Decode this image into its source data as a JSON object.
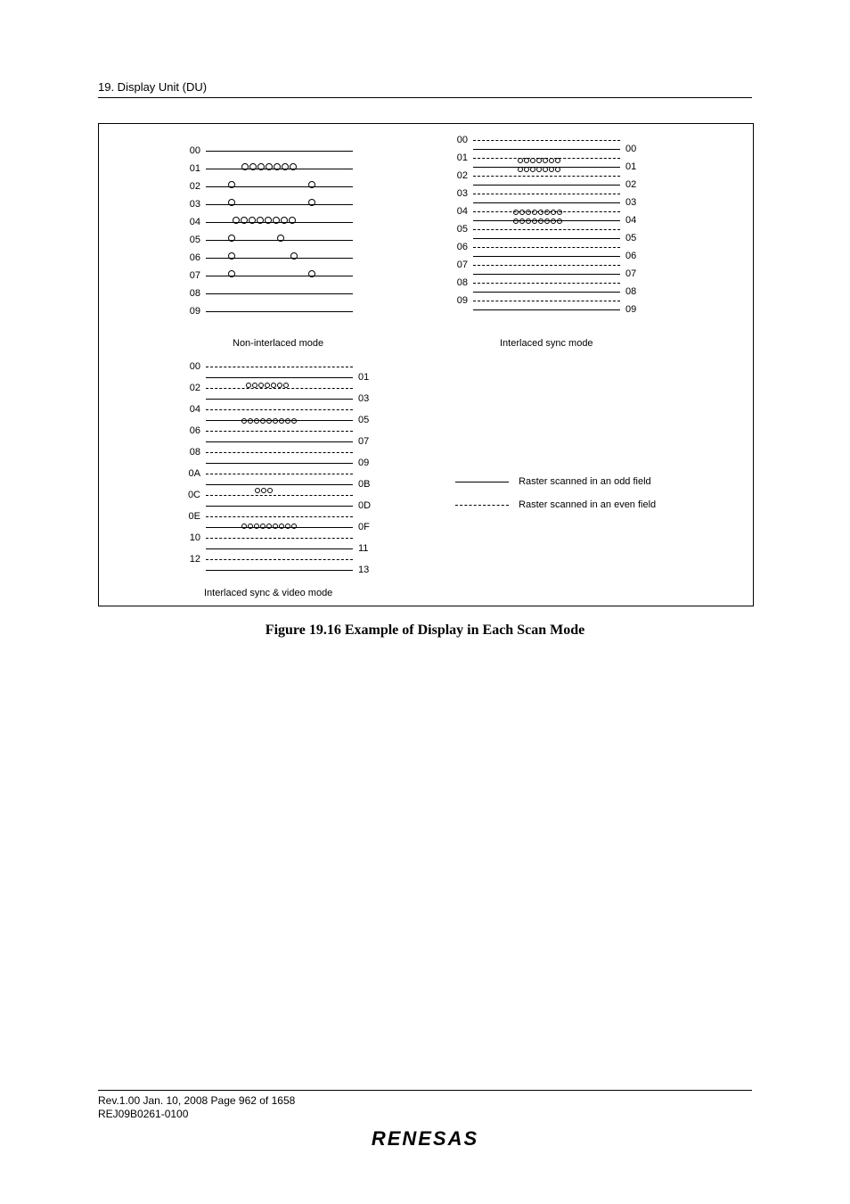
{
  "header": {
    "section": "19.   Display Unit (DU)"
  },
  "fig": {
    "panels": {
      "noninterlaced": {
        "labels": [
          "00",
          "01",
          "02",
          "03",
          "04",
          "05",
          "06",
          "07",
          "08",
          "09"
        ],
        "caption": "Non-interlaced mode"
      },
      "interlaced_sync": {
        "left": [
          "00",
          "01",
          "02",
          "03",
          "04",
          "05",
          "06",
          "07",
          "08",
          "09"
        ],
        "right": [
          "00",
          "01",
          "02",
          "03",
          "04",
          "05",
          "06",
          "07",
          "08",
          "09"
        ],
        "caption": "Interlaced sync mode"
      },
      "interlaced_sync_video": {
        "left": [
          "00",
          "02",
          "04",
          "06",
          "08",
          "0A",
          "0C",
          "0E",
          "10",
          "12"
        ],
        "right": [
          "01",
          "03",
          "05",
          "07",
          "09",
          "0B",
          "0D",
          "0F",
          "11",
          "13"
        ],
        "caption": "Interlaced sync & video mode"
      }
    },
    "legend": {
      "odd": "Raster scanned in an odd field",
      "even": "Raster scanned in an even field"
    },
    "caption": "Figure 19.16   Example of Display in Each Scan Mode"
  },
  "footer": {
    "rev": "Rev.1.00  Jan. 10, 2008  Page 962 of 1658",
    "doc": "REJ09B0261-0100",
    "logo": "RENESAS"
  }
}
